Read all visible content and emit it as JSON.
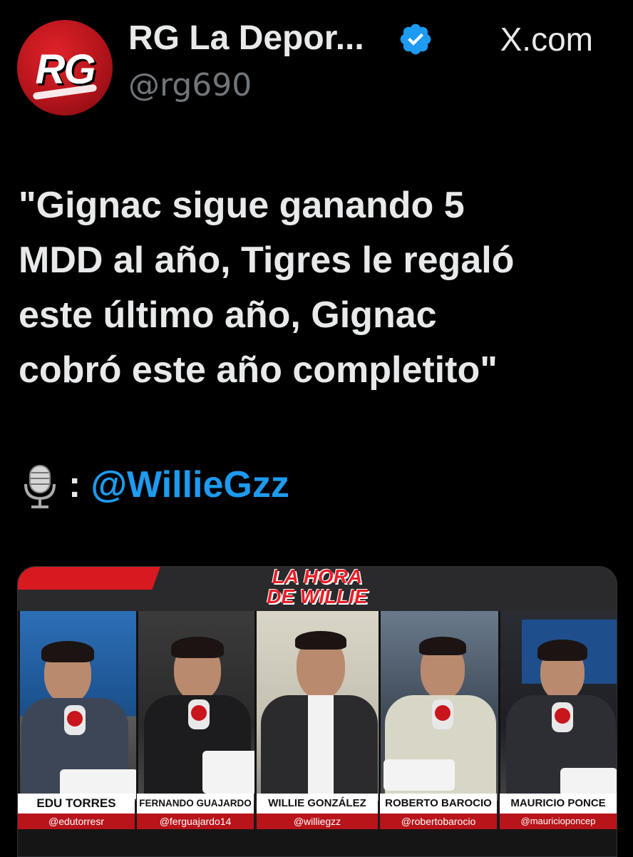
{
  "header": {
    "display_name": "RG La Depor...",
    "handle": "@rg690",
    "avatar_text": "RG",
    "verified_icon": "verified-badge-icon",
    "source_site": "X.com"
  },
  "tweet": {
    "lines": [
      "\"Gignac sigue ganando 5",
      "MDD al año, Tigres le regaló",
      "este último año, Gignac",
      "cobró este año completito\""
    ],
    "mic_icon": "microphone-icon",
    "separator": ":",
    "mention": "@WillieGzz"
  },
  "media": {
    "show_title_line1": "LA HORA",
    "show_title_line2": "DE WILLIE",
    "panelists": [
      {
        "name": "EDU TORRES",
        "handle": "@edutorresr"
      },
      {
        "name": "FERNANDO GUAJARDO",
        "handle": "@ferguajardo14"
      },
      {
        "name": "WILLIE GONZÁLEZ",
        "handle": "@williegzz"
      },
      {
        "name": "ROBERTO BAROCIO",
        "handle": "@robertobarocio"
      },
      {
        "name": "MAURICIO PONCE",
        "handle": "@mauricioponcep"
      }
    ]
  },
  "colors": {
    "background": "#000000",
    "text": "#e7e9ea",
    "secondary_text": "#71767b",
    "link": "#1d9bf0",
    "verified": "#1d9bf0",
    "brand_red": "#d71920"
  }
}
